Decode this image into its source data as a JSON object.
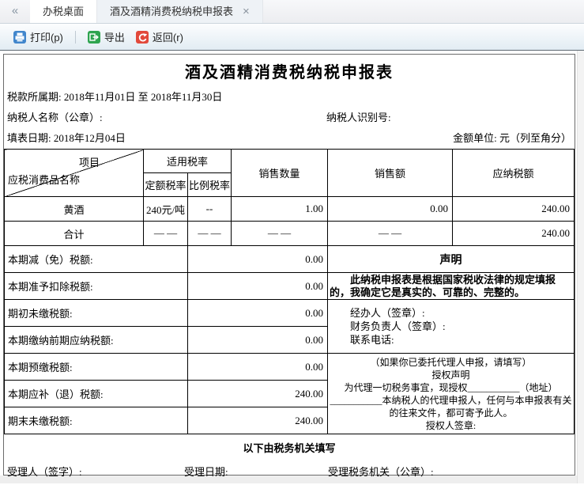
{
  "tabs": {
    "collapse_icon": "«",
    "close_icon": "×",
    "items": [
      {
        "label": "办税桌面"
      },
      {
        "label": "酒及酒精消费税纳税申报表"
      }
    ]
  },
  "toolbar": {
    "print_label": "打印(p)",
    "export_label": "导出",
    "back_label": "返回(r)",
    "print_color": "#4186cc",
    "export_color": "#2ea44f",
    "back_color": "#e2493b"
  },
  "form": {
    "title": "酒及酒精消费税纳税申报表",
    "period_label": "税款所属期:",
    "period_value": "2018年11月01日 至 2018年11月30日",
    "taxpayer_name_label": "纳税人名称（公章）:",
    "taxpayer_id_label": "纳税人识别号:",
    "fill_date_label": "填表日期:",
    "fill_date_value": "2018年12月04日",
    "unit_label": "金额单位: 元（列至角分）"
  },
  "main_table": {
    "corner_top": "项目",
    "corner_bottom": "应税消费品名称",
    "applicable_rate_header": "适用税率",
    "fixed_rate_header": "定额税率",
    "ratio_rate_header": "比例税率",
    "quantity_header": "销售数量",
    "sales_header": "销售额",
    "tax_header": "应纳税额",
    "rows": [
      {
        "name": "黄酒",
        "fixed_rate": "240元/吨",
        "ratio_rate": "--",
        "quantity": "1.00",
        "sales": "0.00",
        "tax": "240.00"
      },
      {
        "name": "合计",
        "fixed_rate": "— —",
        "ratio_rate": "— —",
        "quantity": "— —",
        "sales": "— —",
        "tax": "240.00"
      }
    ]
  },
  "lower_rows": [
    {
      "label": "本期减（免）税额:",
      "value": "0.00"
    },
    {
      "label": "本期准予扣除税额:",
      "value": "0.00"
    },
    {
      "label": "期初未缴税额:",
      "value": "0.00"
    },
    {
      "label": "本期缴纳前期应纳税额:",
      "value": "0.00"
    },
    {
      "label": "本期预缴税额:",
      "value": "0.00"
    },
    {
      "label": "本期应补（退）税额:",
      "value": "240.00"
    },
    {
      "label": "期末未缴税额:",
      "value": "240.00"
    }
  ],
  "declaration": {
    "header": "声明",
    "text": "此纳税申报表是根据国家税收法律的规定填报的，我确定它是真实的、可靠的、完整的。",
    "agent_lines": [
      "经办人（签章）:",
      "财务负责人（签章）:",
      "联系电话:"
    ],
    "authorization_lines": [
      "（如果你已委托代理人申报，请填写）",
      "授权声明",
      "为代理一切税务事宜，现授权___________（地址）",
      "___________本纳税人的代理申报人，任何与本申报表有关",
      "的往来文件，都可寄予此人。",
      "授权人签章:"
    ]
  },
  "tax_office": {
    "header": "以下由税务机关填写",
    "receiver_label": "受理人（签字）:",
    "date_label": "受理日期:",
    "office_label": "受理税务机关（公章）:"
  }
}
